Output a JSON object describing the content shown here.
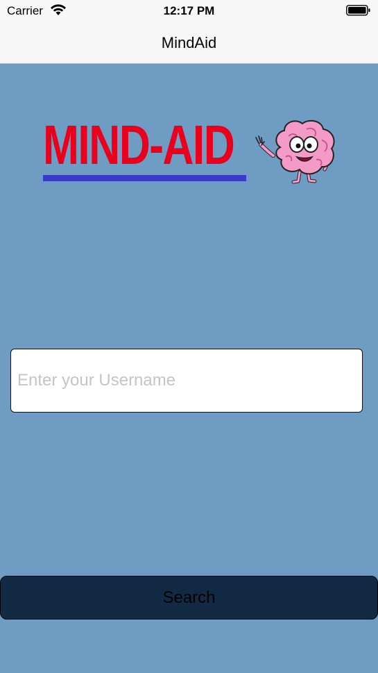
{
  "status_bar": {
    "carrier": "Carrier",
    "time": "12:17 PM",
    "wifi_icon": "wifi-icon",
    "battery_icon": "battery-icon"
  },
  "nav": {
    "title": "MindAid"
  },
  "logo": {
    "text": "MIND-AID",
    "text_color": "#e8001c",
    "underline_color": "#3a3acb",
    "mascot": "brain-mascot"
  },
  "username": {
    "placeholder": "Enter your Username",
    "value": ""
  },
  "search": {
    "label": "Search"
  },
  "colors": {
    "background": "#6f9cc3",
    "button": "#132a45",
    "bar": "#f7f7f7"
  }
}
